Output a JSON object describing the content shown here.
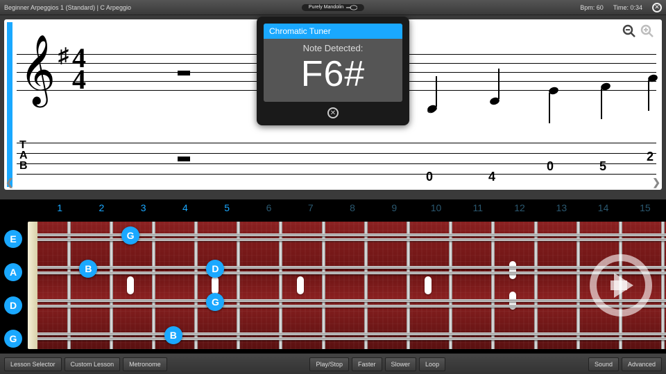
{
  "header": {
    "title": "Beginner Arpeggios 1 (Standard)  |  C Arpeggio",
    "logo": "Purely Mandolin",
    "bpm_label": "Bpm: 60",
    "time_label": "Time: 0:34"
  },
  "tuner": {
    "title": "Chromatic Tuner",
    "label": "Note Detected:",
    "note": "F6#"
  },
  "notation": {
    "time_top": "4",
    "time_bottom": "4",
    "tab_letters": [
      "T",
      "A",
      "B"
    ],
    "tab_values": [
      "0",
      "4",
      "0",
      "5",
      "2"
    ]
  },
  "fret_numbers": [
    "1",
    "2",
    "3",
    "4",
    "5",
    "6",
    "7",
    "8",
    "9",
    "10",
    "11",
    "12",
    "13",
    "14",
    "15"
  ],
  "open_strings": [
    "E",
    "A",
    "D",
    "G"
  ],
  "fret_notes": [
    {
      "string": 0,
      "fret": 3,
      "label": "G"
    },
    {
      "string": 1,
      "fret": 2,
      "label": "B"
    },
    {
      "string": 1,
      "fret": 5,
      "label": "D"
    },
    {
      "string": 2,
      "fret": 5,
      "label": "G"
    },
    {
      "string": 3,
      "fret": 4,
      "label": "B"
    }
  ],
  "buttons": {
    "lesson_selector": "Lesson Selector",
    "custom_lesson": "Custom Lesson",
    "metronome": "Metronome",
    "play_stop": "Play/Stop",
    "faster": "Faster",
    "slower": "Slower",
    "loop": "Loop",
    "sound": "Sound",
    "advanced": "Advanced"
  },
  "colors": {
    "accent": "#1aa8ff"
  }
}
